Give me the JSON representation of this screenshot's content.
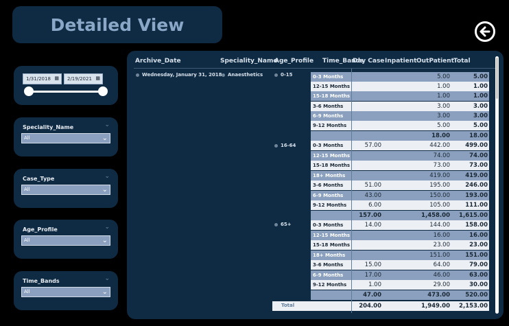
{
  "page_title": "Detailed View",
  "back_icon": "back-arrow-circle-icon",
  "date_slicer": {
    "start": "1/31/2018",
    "end": "2/19/2021",
    "calendar_icon": "calendar-icon"
  },
  "slicers": [
    {
      "title": "Speciality_Name",
      "value": "All"
    },
    {
      "title": "Case_Type",
      "value": "All"
    },
    {
      "title": "Age_Profile",
      "value": "All"
    },
    {
      "title": "Time_Bands",
      "value": "All"
    }
  ],
  "table": {
    "headers": {
      "archive_date": "Archive_Date",
      "speciality_name": "Speciality_Name",
      "age_profile": "Age_Profile",
      "time_bands": "Time_Bands",
      "day_case": "Day Case",
      "inpatient": "Inpatient",
      "outpatient": "OutPatient",
      "total": "Total"
    },
    "archive_date": "Wednesday, January 31, 2018",
    "speciality": "Anaesthetics",
    "age_groups": [
      "0-15",
      "16-64",
      "65+"
    ],
    "rows": [
      {
        "band": "0-3 Months",
        "day_case": "",
        "inpatient": "",
        "outpatient": "5.00",
        "total": "5.00"
      },
      {
        "band": "12-15 Months",
        "day_case": "",
        "inpatient": "",
        "outpatient": "1.00",
        "total": "1.00"
      },
      {
        "band": "15-18 Months",
        "day_case": "",
        "inpatient": "",
        "outpatient": "1.00",
        "total": "1.00"
      },
      {
        "band": "3-6 Months",
        "day_case": "",
        "inpatient": "",
        "outpatient": "3.00",
        "total": "3.00"
      },
      {
        "band": "6-9 Months",
        "day_case": "",
        "inpatient": "",
        "outpatient": "3.00",
        "total": "3.00"
      },
      {
        "band": "9-12 Months",
        "day_case": "",
        "inpatient": "",
        "outpatient": "5.00",
        "total": "5.00"
      },
      {
        "band": "",
        "day_case": "",
        "inpatient": "",
        "outpatient": "18.00",
        "total": "18.00"
      },
      {
        "band": "0-3 Months",
        "day_case": "57.00",
        "inpatient": "",
        "outpatient": "442.00",
        "total": "499.00"
      },
      {
        "band": "12-15 Months",
        "day_case": "",
        "inpatient": "",
        "outpatient": "74.00",
        "total": "74.00"
      },
      {
        "band": "15-18 Months",
        "day_case": "",
        "inpatient": "",
        "outpatient": "73.00",
        "total": "73.00"
      },
      {
        "band": "18+ Months",
        "day_case": "",
        "inpatient": "",
        "outpatient": "419.00",
        "total": "419.00"
      },
      {
        "band": "3-6 Months",
        "day_case": "51.00",
        "inpatient": "",
        "outpatient": "195.00",
        "total": "246.00"
      },
      {
        "band": "6-9 Months",
        "day_case": "43.00",
        "inpatient": "",
        "outpatient": "150.00",
        "total": "193.00"
      },
      {
        "band": "9-12 Months",
        "day_case": "6.00",
        "inpatient": "",
        "outpatient": "105.00",
        "total": "111.00"
      },
      {
        "band": "",
        "day_case": "157.00",
        "inpatient": "",
        "outpatient": "1,458.00",
        "total": "1,615.00"
      },
      {
        "band": "0-3 Months",
        "day_case": "14.00",
        "inpatient": "",
        "outpatient": "144.00",
        "total": "158.00"
      },
      {
        "band": "12-15 Months",
        "day_case": "",
        "inpatient": "",
        "outpatient": "16.00",
        "total": "16.00"
      },
      {
        "band": "15-18 Months",
        "day_case": "",
        "inpatient": "",
        "outpatient": "23.00",
        "total": "23.00"
      },
      {
        "band": "18+ Months",
        "day_case": "",
        "inpatient": "",
        "outpatient": "151.00",
        "total": "151.00"
      },
      {
        "band": "3-6 Months",
        "day_case": "15.00",
        "inpatient": "",
        "outpatient": "64.00",
        "total": "79.00"
      },
      {
        "band": "6-9 Months",
        "day_case": "17.00",
        "inpatient": "",
        "outpatient": "46.00",
        "total": "63.00"
      },
      {
        "band": "9-12 Months",
        "day_case": "1.00",
        "inpatient": "",
        "outpatient": "29.00",
        "total": "30.00"
      },
      {
        "band": "",
        "day_case": "47.00",
        "inpatient": "",
        "outpatient": "473.00",
        "total": "520.00"
      },
      {
        "band": "",
        "day_case": "204.00",
        "inpatient": "",
        "outpatient": "1,949.00",
        "total": "2,153.00"
      }
    ],
    "total_label": "Total"
  }
}
